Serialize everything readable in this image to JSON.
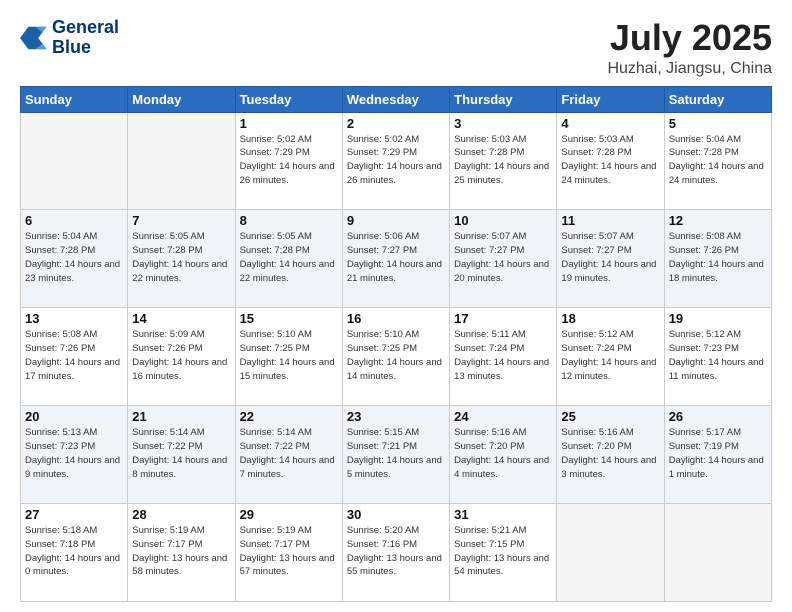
{
  "header": {
    "logo_line1": "General",
    "logo_line2": "Blue",
    "month": "July 2025",
    "location": "Huzhai, Jiangsu, China"
  },
  "days_of_week": [
    "Sunday",
    "Monday",
    "Tuesday",
    "Wednesday",
    "Thursday",
    "Friday",
    "Saturday"
  ],
  "weeks": [
    [
      {
        "day": "",
        "info": ""
      },
      {
        "day": "",
        "info": ""
      },
      {
        "day": "1",
        "sunrise": "5:02 AM",
        "sunset": "7:29 PM",
        "daylight": "14 hours and 26 minutes."
      },
      {
        "day": "2",
        "sunrise": "5:02 AM",
        "sunset": "7:29 PM",
        "daylight": "14 hours and 26 minutes."
      },
      {
        "day": "3",
        "sunrise": "5:03 AM",
        "sunset": "7:28 PM",
        "daylight": "14 hours and 25 minutes."
      },
      {
        "day": "4",
        "sunrise": "5:03 AM",
        "sunset": "7:28 PM",
        "daylight": "14 hours and 24 minutes."
      },
      {
        "day": "5",
        "sunrise": "5:04 AM",
        "sunset": "7:28 PM",
        "daylight": "14 hours and 24 minutes."
      }
    ],
    [
      {
        "day": "6",
        "sunrise": "5:04 AM",
        "sunset": "7:28 PM",
        "daylight": "14 hours and 23 minutes."
      },
      {
        "day": "7",
        "sunrise": "5:05 AM",
        "sunset": "7:28 PM",
        "daylight": "14 hours and 22 minutes."
      },
      {
        "day": "8",
        "sunrise": "5:05 AM",
        "sunset": "7:28 PM",
        "daylight": "14 hours and 22 minutes."
      },
      {
        "day": "9",
        "sunrise": "5:06 AM",
        "sunset": "7:27 PM",
        "daylight": "14 hours and 21 minutes."
      },
      {
        "day": "10",
        "sunrise": "5:07 AM",
        "sunset": "7:27 PM",
        "daylight": "14 hours and 20 minutes."
      },
      {
        "day": "11",
        "sunrise": "5:07 AM",
        "sunset": "7:27 PM",
        "daylight": "14 hours and 19 minutes."
      },
      {
        "day": "12",
        "sunrise": "5:08 AM",
        "sunset": "7:26 PM",
        "daylight": "14 hours and 18 minutes."
      }
    ],
    [
      {
        "day": "13",
        "sunrise": "5:08 AM",
        "sunset": "7:26 PM",
        "daylight": "14 hours and 17 minutes."
      },
      {
        "day": "14",
        "sunrise": "5:09 AM",
        "sunset": "7:26 PM",
        "daylight": "14 hours and 16 minutes."
      },
      {
        "day": "15",
        "sunrise": "5:10 AM",
        "sunset": "7:25 PM",
        "daylight": "14 hours and 15 minutes."
      },
      {
        "day": "16",
        "sunrise": "5:10 AM",
        "sunset": "7:25 PM",
        "daylight": "14 hours and 14 minutes."
      },
      {
        "day": "17",
        "sunrise": "5:11 AM",
        "sunset": "7:24 PM",
        "daylight": "14 hours and 13 minutes."
      },
      {
        "day": "18",
        "sunrise": "5:12 AM",
        "sunset": "7:24 PM",
        "daylight": "14 hours and 12 minutes."
      },
      {
        "day": "19",
        "sunrise": "5:12 AM",
        "sunset": "7:23 PM",
        "daylight": "14 hours and 11 minutes."
      }
    ],
    [
      {
        "day": "20",
        "sunrise": "5:13 AM",
        "sunset": "7:23 PM",
        "daylight": "14 hours and 9 minutes."
      },
      {
        "day": "21",
        "sunrise": "5:14 AM",
        "sunset": "7:22 PM",
        "daylight": "14 hours and 8 minutes."
      },
      {
        "day": "22",
        "sunrise": "5:14 AM",
        "sunset": "7:22 PM",
        "daylight": "14 hours and 7 minutes."
      },
      {
        "day": "23",
        "sunrise": "5:15 AM",
        "sunset": "7:21 PM",
        "daylight": "14 hours and 5 minutes."
      },
      {
        "day": "24",
        "sunrise": "5:16 AM",
        "sunset": "7:20 PM",
        "daylight": "14 hours and 4 minutes."
      },
      {
        "day": "25",
        "sunrise": "5:16 AM",
        "sunset": "7:20 PM",
        "daylight": "14 hours and 3 minutes."
      },
      {
        "day": "26",
        "sunrise": "5:17 AM",
        "sunset": "7:19 PM",
        "daylight": "14 hours and 1 minute."
      }
    ],
    [
      {
        "day": "27",
        "sunrise": "5:18 AM",
        "sunset": "7:18 PM",
        "daylight": "14 hours and 0 minutes."
      },
      {
        "day": "28",
        "sunrise": "5:19 AM",
        "sunset": "7:17 PM",
        "daylight": "13 hours and 58 minutes."
      },
      {
        "day": "29",
        "sunrise": "5:19 AM",
        "sunset": "7:17 PM",
        "daylight": "13 hours and 57 minutes."
      },
      {
        "day": "30",
        "sunrise": "5:20 AM",
        "sunset": "7:16 PM",
        "daylight": "13 hours and 55 minutes."
      },
      {
        "day": "31",
        "sunrise": "5:21 AM",
        "sunset": "7:15 PM",
        "daylight": "13 hours and 54 minutes."
      },
      {
        "day": "",
        "info": ""
      },
      {
        "day": "",
        "info": ""
      }
    ]
  ]
}
